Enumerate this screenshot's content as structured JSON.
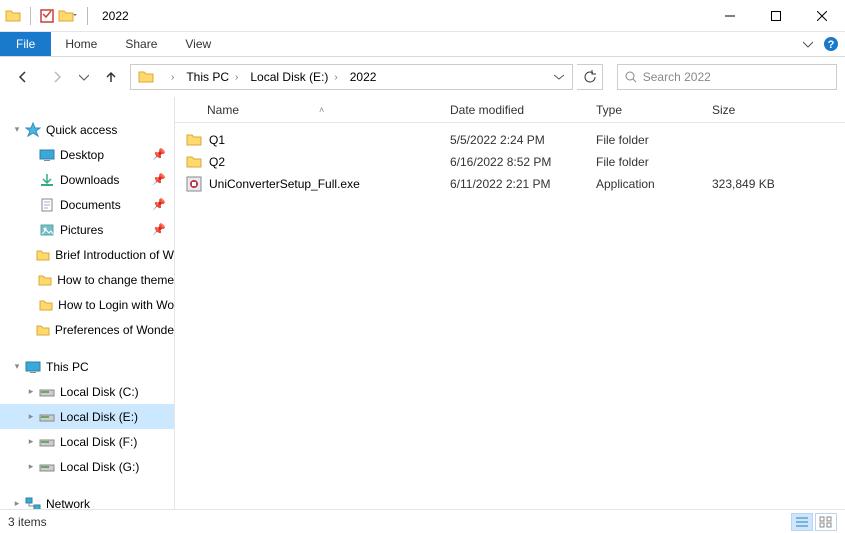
{
  "title": "2022",
  "ribbon": {
    "file": "File",
    "tabs": [
      "Home",
      "Share",
      "View"
    ]
  },
  "breadcrumbs": [
    "This PC",
    "Local Disk (E:)",
    "2022"
  ],
  "search_placeholder": "Search 2022",
  "nav": {
    "quick_access": "Quick access",
    "pinned": [
      {
        "label": "Desktop",
        "icon": "desktop"
      },
      {
        "label": "Downloads",
        "icon": "downloads"
      },
      {
        "label": "Documents",
        "icon": "documents"
      },
      {
        "label": "Pictures",
        "icon": "pictures"
      }
    ],
    "recent": [
      "Brief Introduction of W",
      "How to change theme",
      "How to Login with Wo",
      "Preferences of Wonde"
    ],
    "this_pc": "This PC",
    "drives": [
      {
        "label": "Local Disk (C:)"
      },
      {
        "label": "Local Disk (E:)",
        "selected": true
      },
      {
        "label": "Local Disk (F:)"
      },
      {
        "label": "Local Disk (G:)"
      }
    ],
    "network": "Network"
  },
  "columns": {
    "name": "Name",
    "date": "Date modified",
    "type": "Type",
    "size": "Size"
  },
  "rows": [
    {
      "name": "Q1",
      "date": "5/5/2022 2:24 PM",
      "type": "File folder",
      "size": "",
      "icon": "folder"
    },
    {
      "name": "Q2",
      "date": "6/16/2022 8:52 PM",
      "type": "File folder",
      "size": "",
      "icon": "folder"
    },
    {
      "name": "UniConverterSetup_Full.exe",
      "date": "6/11/2022 2:21 PM",
      "type": "Application",
      "size": "323,849 KB",
      "icon": "exe"
    }
  ],
  "status": {
    "items": "3 items"
  }
}
